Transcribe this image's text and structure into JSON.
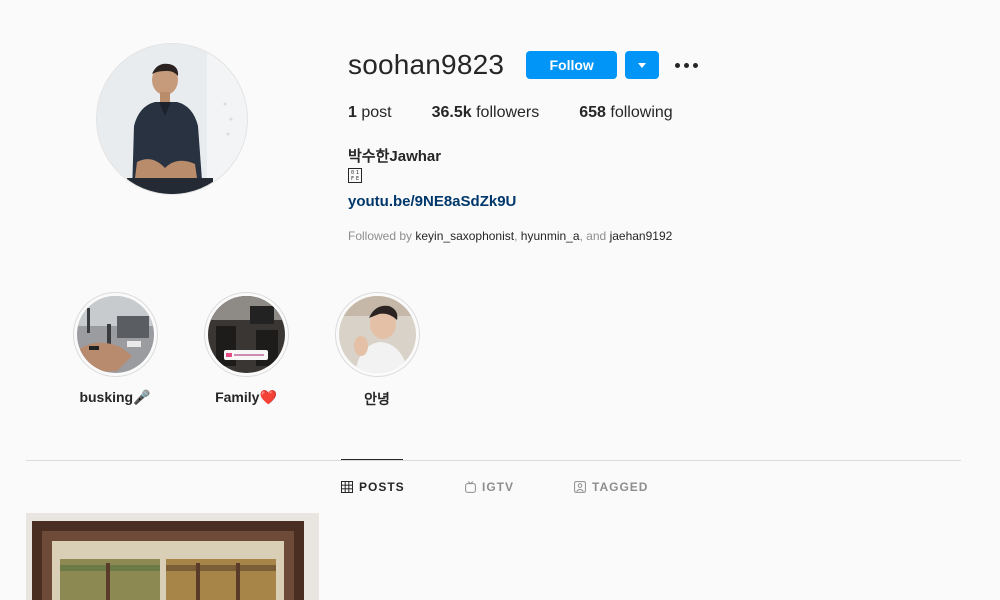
{
  "profile": {
    "username": "soohan9823",
    "follow_label": "Follow",
    "stats": {
      "posts_count": "1",
      "posts_label": "post",
      "followers_count": "36.5k",
      "followers_label": "followers",
      "following_count": "658",
      "following_label": "following"
    },
    "full_name": "박수한Jawhar",
    "bio_glyph": "",
    "link": "youtu.be/9NE8aSdZk9U",
    "followed_by": {
      "prefix": "Followed by",
      "users": [
        "keyin_saxophonist",
        "hyunmin_a",
        "jaehan9192"
      ],
      "sep1": ",",
      "sep2": ", and"
    }
  },
  "highlights": [
    {
      "label": "busking",
      "emoji": "🎤"
    },
    {
      "label": "Family",
      "emoji": "❤️"
    },
    {
      "label": "안녕",
      "emoji": ""
    }
  ],
  "tabs": [
    {
      "label": "POSTS",
      "icon": "grid-icon",
      "active": true
    },
    {
      "label": "IGTV",
      "icon": "igtv-icon",
      "active": false
    },
    {
      "label": "TAGGED",
      "icon": "tagged-icon",
      "active": false
    }
  ],
  "colors": {
    "primary_button": "#0095f6",
    "link": "#00376b",
    "muted_text": "#8e8e8e",
    "background": "#fafafa"
  }
}
